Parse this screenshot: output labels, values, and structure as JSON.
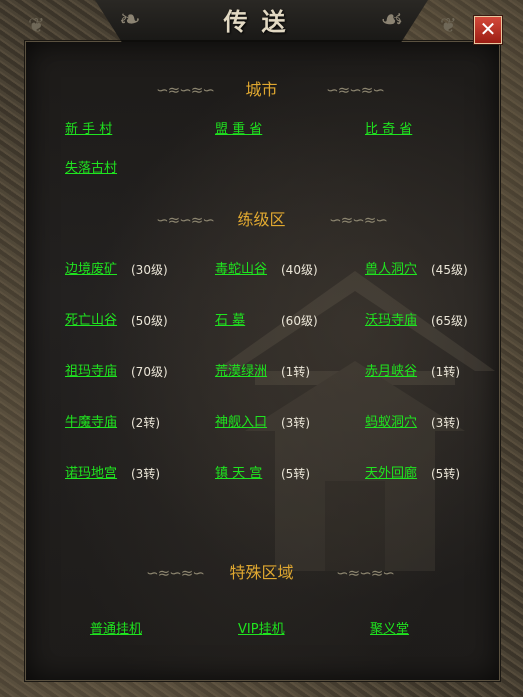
{
  "window": {
    "title": "传送",
    "close_icon": "close-icon"
  },
  "sections": {
    "city": {
      "title": "城市"
    },
    "training": {
      "title": "练级区"
    },
    "special": {
      "title": "特殊区域"
    }
  },
  "city_links": [
    "新 手 村",
    "盟 重 省",
    "比 奇 省",
    "失落古村"
  ],
  "training_links": [
    {
      "name": "边境废矿",
      "level": "(30级)"
    },
    {
      "name": "毒蛇山谷",
      "level": "(40级)"
    },
    {
      "name": "兽人洞穴",
      "level": "(45级)"
    },
    {
      "name": "死亡山谷",
      "level": "(50级)"
    },
    {
      "name": "石      墓",
      "level": "(60级)"
    },
    {
      "name": "沃玛寺庙",
      "level": "(65级)"
    },
    {
      "name": "祖玛寺庙",
      "level": "(70级)"
    },
    {
      "name": "荒漠绿洲",
      "level": "(1转)"
    },
    {
      "name": "赤月峡谷",
      "level": "(1转)"
    },
    {
      "name": "牛魔寺庙",
      "level": "(2转)"
    },
    {
      "name": "神舰入口",
      "level": "(3转)"
    },
    {
      "name": "蚂蚁洞穴",
      "level": "(3转)"
    },
    {
      "name": "诺玛地宫",
      "level": "(3转)"
    },
    {
      "name": "镇 天 宫",
      "level": "(5转)"
    },
    {
      "name": "天外回廊",
      "level": "(5转)"
    }
  ],
  "special_links": [
    "普通挂机",
    "VIP挂机",
    "聚义堂"
  ],
  "colors": {
    "link": "#1fe41f",
    "section_title": "#e0a830",
    "level_text": "#ebe6d8",
    "close_bg": "#c23a2c"
  }
}
